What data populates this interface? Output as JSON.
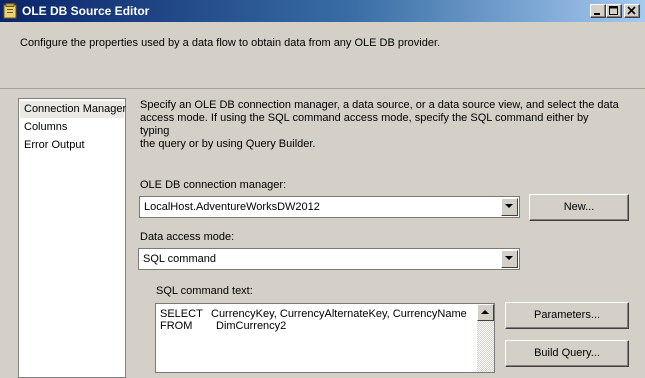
{
  "window": {
    "title": "OLE DB Source Editor",
    "controls": [
      "minimize-icon",
      "maximize-icon",
      "close-icon"
    ]
  },
  "header": {
    "description": "Configure the properties used by a data flow to obtain data from any OLE DB provider."
  },
  "nav": {
    "items": [
      {
        "label": "Connection Manager",
        "selected": true
      },
      {
        "label": "Columns",
        "selected": false
      },
      {
        "label": "Error Output",
        "selected": false
      }
    ]
  },
  "main": {
    "instructions_line1": "Specify an OLE DB connection manager, a data source, or a data source view, and select the data",
    "instructions_line2": "access mode. If using the SQL command access mode, specify the SQL command either by typing",
    "instructions_line3": "the query or by using Query Builder.",
    "connection_label": "OLE DB connection manager:",
    "connection_value": "LocalHost.AdventureWorksDW2012",
    "new_button": "New...",
    "access_mode_label": "Data access mode:",
    "access_mode_value": "SQL command",
    "sql_label": "SQL command text:",
    "sql_lines": [
      {
        "keyword": "SELECT",
        "text": "CurrencyKey, CurrencyAlternateKey, CurrencyName"
      },
      {
        "keyword": "FROM",
        "text": "DimCurrency2"
      }
    ],
    "parameters_button": "Parameters...",
    "build_query_button": "Build Query..."
  },
  "colors": {
    "title_start": "#0a246a",
    "title_end": "#a6caf0",
    "face": "#d4d0c8",
    "selected_nav": "#ebe9e3"
  }
}
